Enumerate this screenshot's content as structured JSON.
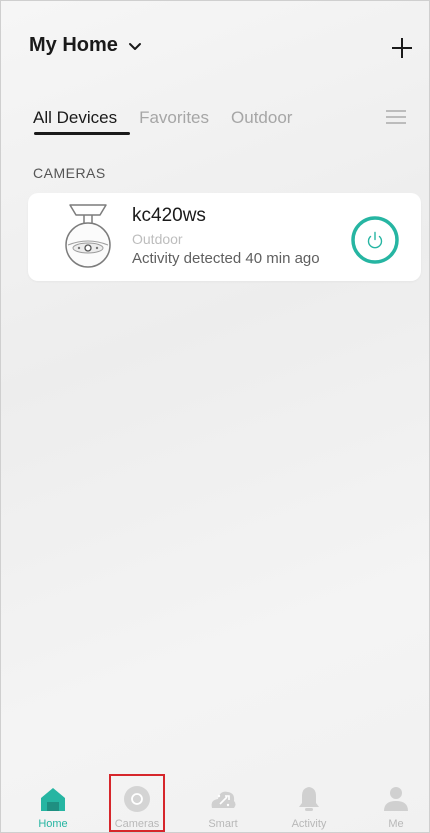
{
  "header": {
    "home_title": "My Home"
  },
  "tabs": [
    {
      "label": "All Devices",
      "active": true
    },
    {
      "label": "Favorites",
      "active": false
    },
    {
      "label": "Outdoor",
      "active": false
    }
  ],
  "section_label": "CAMERAS",
  "device": {
    "name": "kc420ws",
    "location": "Outdoor",
    "activity": "Activity detected 40 min ago"
  },
  "tabbar": [
    {
      "label": "Home",
      "icon": "home-icon",
      "active": true
    },
    {
      "label": "Cameras",
      "icon": "camera-icon",
      "active": false
    },
    {
      "label": "Smart",
      "icon": "smart-icon",
      "active": false
    },
    {
      "label": "Activity",
      "icon": "bell-icon",
      "active": false
    },
    {
      "label": "Me",
      "icon": "user-icon",
      "active": false
    }
  ],
  "colors": {
    "accent": "#26b5a2",
    "highlight": "#d6262b",
    "inactive": "#b8b8b8"
  }
}
